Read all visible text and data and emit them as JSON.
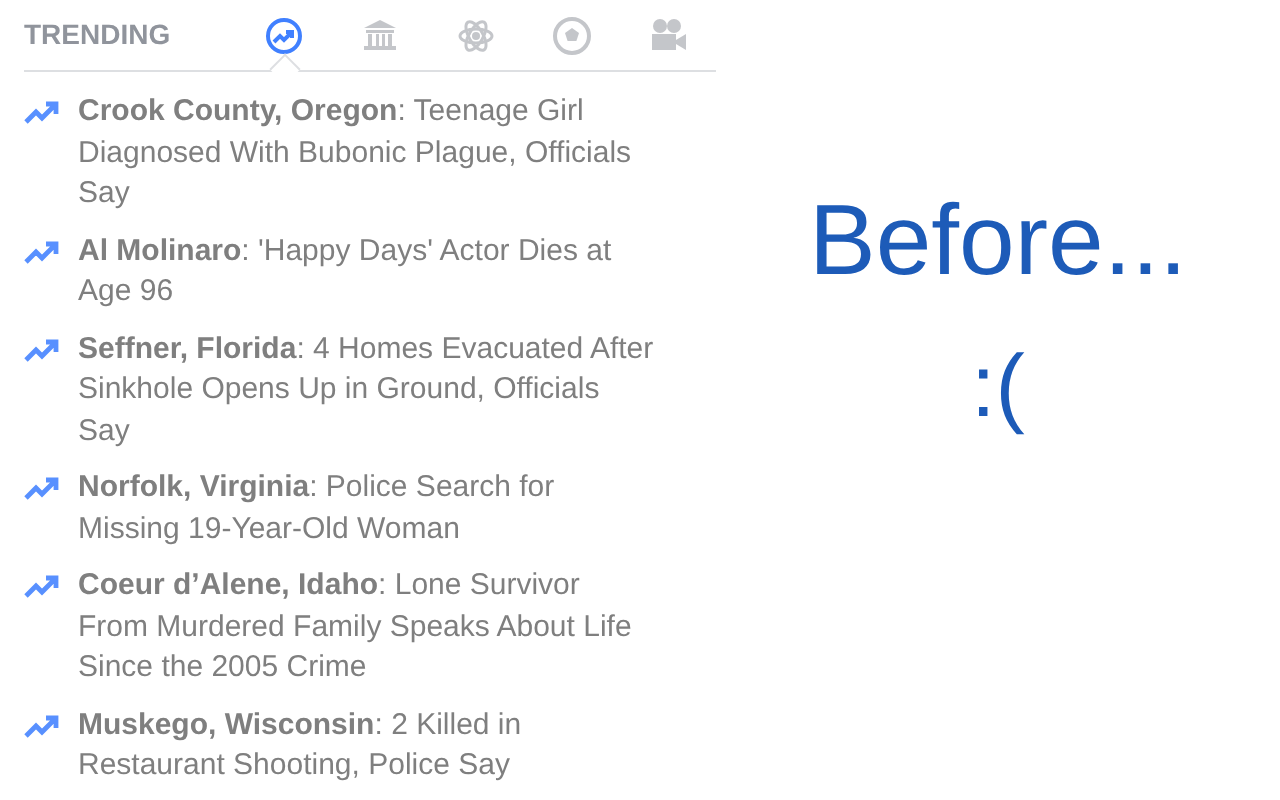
{
  "panel": {
    "title": "TRENDING",
    "tabs": [
      {
        "kind": "trending",
        "selected": true
      },
      {
        "kind": "building",
        "selected": false
      },
      {
        "kind": "atom",
        "selected": false
      },
      {
        "kind": "ball",
        "selected": false
      },
      {
        "kind": "camera",
        "selected": false
      }
    ],
    "items": [
      {
        "text": "**Crook County, Oregon**: Teenage Girl Diagnosed With Bubonic Plague, Officials Say"
      },
      {
        "text": "**Al Molinaro**: 'Happy Days' Actor Dies at Age 96"
      },
      {
        "text": "**Seffner, Florida**: 4 Homes Evacuated After Sinkhole Opens Up in Ground, Officials Say"
      },
      {
        "text": "**Norfolk, Virginia**: Police Search for Missing 19-Year-Old Woman"
      },
      {
        "text": "**Coeur d’Alene, Idaho**: Lone Survivor From Murdered Family Speaks About Life Since the 2005 Crime"
      },
      {
        "text": "**Muskego, Wisconsin**: 2 Killed in Restaurant Shooting, Police Say"
      }
    ]
  },
  "caption": {
    "title": "Before...",
    "face": ":("
  }
}
